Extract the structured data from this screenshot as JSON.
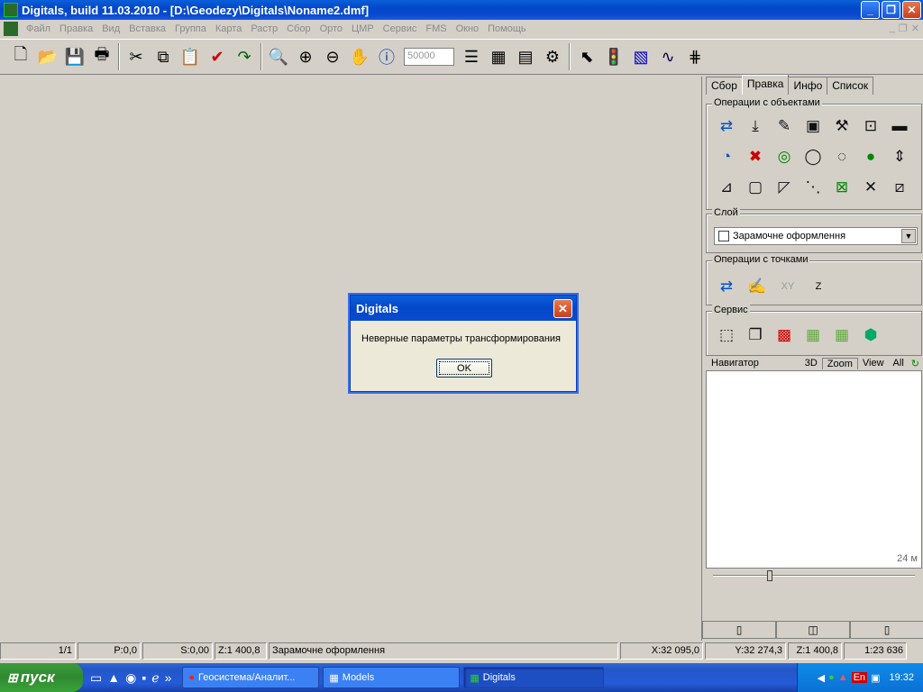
{
  "window": {
    "title": "Digitals, build 11.03.2010 - [D:\\Geodezy\\Digitals\\Noname2.dmf]",
    "minimize": "_",
    "restore": "❐",
    "close": "✕"
  },
  "menu": [
    "Файл",
    "Правка",
    "Вид",
    "Вставка",
    "Группа",
    "Карта",
    "Растр",
    "Сбор",
    "Орто",
    "ЦМР",
    "Сервис",
    "FMS",
    "Окно",
    "Помощь"
  ],
  "toolbar": {
    "scale_value": "50000"
  },
  "panel": {
    "tabs": [
      "Сбор",
      "Правка",
      "Инфо",
      "Список"
    ],
    "active_tab": "Правка",
    "objects_group": "Операции с объектами",
    "layer_group": "Слой",
    "layer_value": "Зарамочне оформлення",
    "points_group": "Операции с точками",
    "points_xy": "XY",
    "points_z": "Z",
    "service_group": "Сервис",
    "navigator_group": "Навигатор",
    "nav_tabs": [
      "3D",
      "Zoom",
      "View",
      "All"
    ],
    "nav_scale": "24 м"
  },
  "status": {
    "pages": "1/1",
    "p": "P:0,0",
    "s": "S:0,00",
    "z": "Z:1 400,8",
    "layer": "Зарамочне оформлення",
    "x": "X:32 095,0",
    "y": "Y:32 274,3",
    "z2": "Z:1 400,8",
    "scale": "1:23 636"
  },
  "dialog": {
    "title": "Digitals",
    "message": "Неверные параметры трансформирования",
    "ok_label": "OK"
  },
  "taskbar": {
    "start_label": "пуск",
    "tasks": [
      "Геосистема/Аналит...",
      "Models",
      "Digitals"
    ],
    "lang": "En",
    "clock": "19:32"
  }
}
